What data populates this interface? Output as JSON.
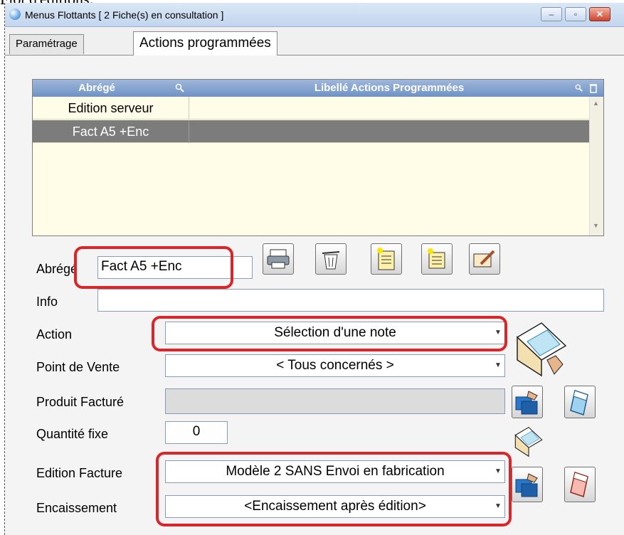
{
  "page_top_text": "Flot d'éditions.",
  "window": {
    "title": "Menus Flottants  [ 2 Fiche(s) en consultation ]",
    "controls": {
      "minimize": "–",
      "maximize": "▫",
      "close": "✕"
    }
  },
  "tabs": [
    {
      "label": "Paramétrage"
    },
    {
      "label": "Actions programmées"
    }
  ],
  "grid": {
    "headers": {
      "abrege": "Abrégé",
      "libelle": "Libellé Actions Programmées"
    },
    "rows": [
      {
        "abrege": "Edition serveur",
        "libelle": ""
      },
      {
        "abrege": "Fact A5 +Enc",
        "libelle": ""
      }
    ]
  },
  "form": {
    "abrege_label": "Abrégé",
    "abrege_value": "Fact A5 +Enc",
    "info_label": "Info",
    "info_value": "",
    "action_label": "Action",
    "action_value": "Sélection d'une note",
    "pdv_label": "Point de Vente",
    "pdv_value": "< Tous concernés >",
    "produit_label": "Produit Facturé",
    "produit_value": "",
    "qte_label": "Quantité fixe",
    "qte_value": "0",
    "edition_label": "Edition Facture",
    "edition_value": "Modèle 2 SANS Envoi en fabrication",
    "encaissement_label": "Encaissement",
    "encaissement_value": "<Encaissement après édition>"
  },
  "toolbar": [
    "printer-icon",
    "trash-icon",
    "new-document-icon",
    "open-folder-icon",
    "edit-document-icon"
  ],
  "colors": {
    "highlight": "#d9262a",
    "selected_row": "#7c7c7c",
    "grid_header": "#7f9ccb"
  }
}
